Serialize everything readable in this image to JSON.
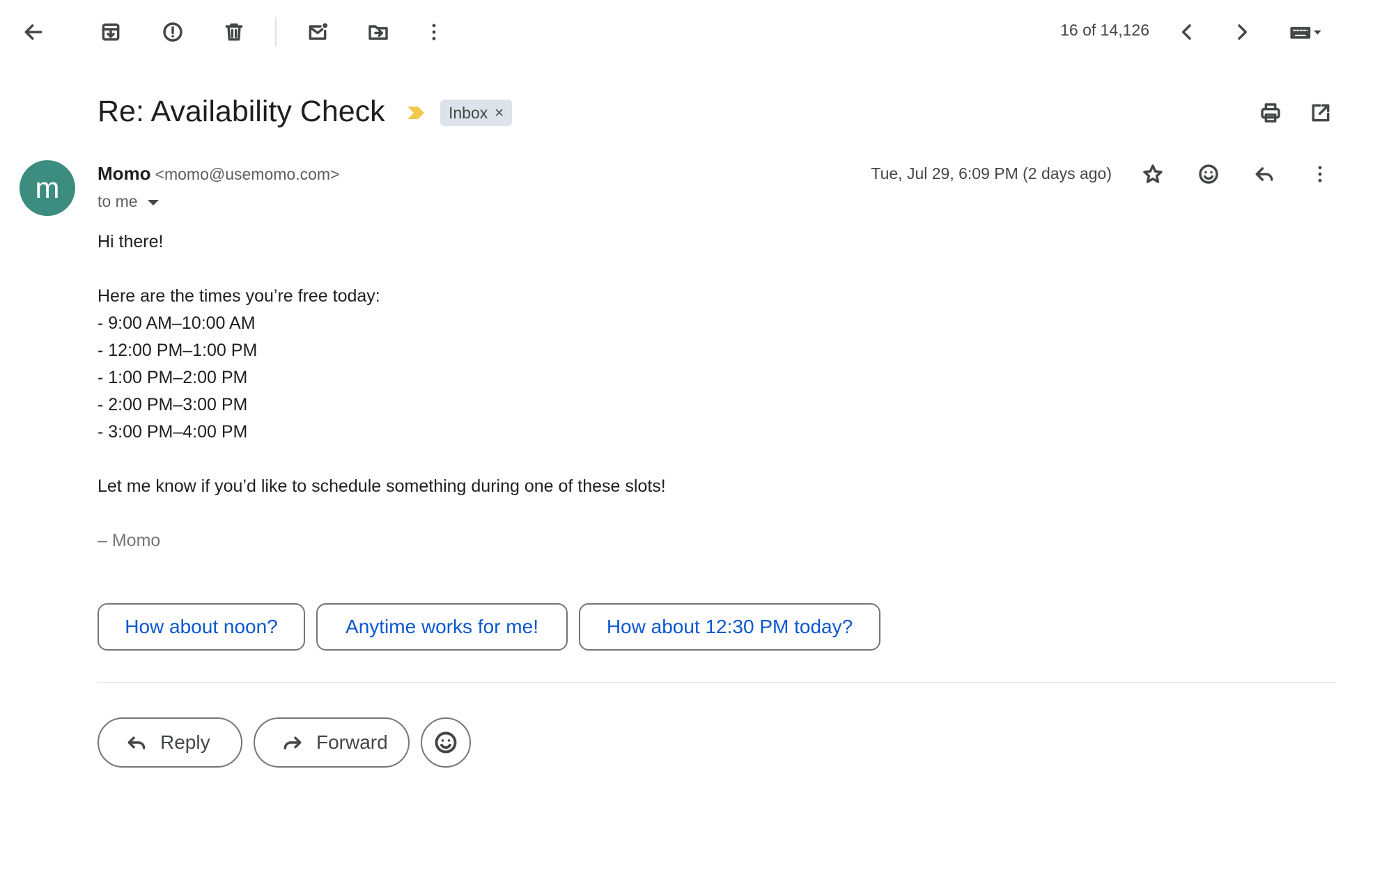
{
  "toolbar": {
    "back_icon": "arrow-left-icon",
    "archive_icon": "archive-icon",
    "report_spam_icon": "report-spam-icon",
    "delete_icon": "trash-icon",
    "mark_unread_icon": "mark-unread-icon",
    "move_to_icon": "move-to-folder-icon",
    "more_icon": "more-vertical-icon",
    "pager_text": "16 of 14,126",
    "prev_icon": "chevron-left-icon",
    "next_icon": "chevron-right-icon",
    "input_tools_icon": "keyboard-icon"
  },
  "email": {
    "subject": "Re: Availability Check",
    "label": "Inbox",
    "label_remove": "×",
    "sender": {
      "initial": "m",
      "avatar_color": "#3c8c7f",
      "name": "Momo",
      "email": "<momo@usemomo.com>"
    },
    "recipient_text": "to me",
    "date": "Tue, Jul 29, 6:09 PM (2 days ago)",
    "body": {
      "greeting": "Hi there!",
      "intro": "Here are the times you’re free today:",
      "slots": [
        "- 9:00 AM–10:00 AM",
        "- 12:00 PM–1:00 PM",
        "- 1:00 PM–2:00 PM",
        "- 2:00 PM–3:00 PM",
        "- 3:00 PM–4:00 PM"
      ],
      "closing": "Let me know if you’d like to schedule something during one of these slots!",
      "signature": "– Momo"
    }
  },
  "smart_replies": [
    "How about noon?",
    "Anytime works for me!",
    "How about 12:30 PM today?"
  ],
  "actions": {
    "reply_label": "Reply",
    "forward_label": "Forward"
  },
  "colors": {
    "accent_link": "#0b57d0",
    "importance_marker": "#f2c94c",
    "label_chip_bg": "#dde3ea"
  }
}
